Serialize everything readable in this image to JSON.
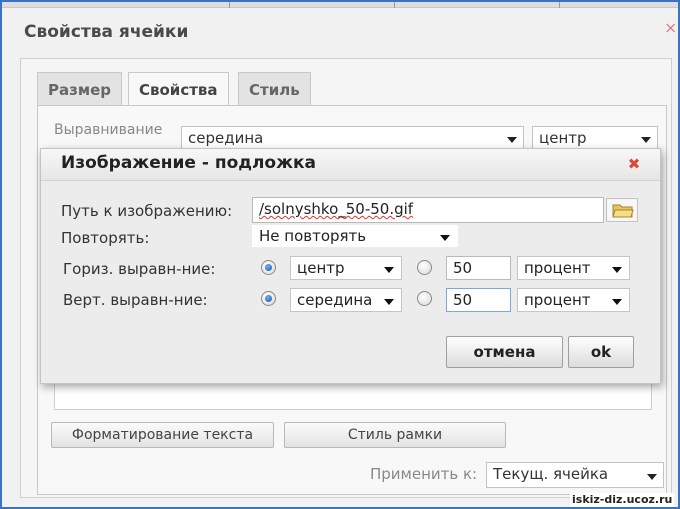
{
  "outer_dialog": {
    "title": "Свойства ячейки",
    "close_glyph": "⨯",
    "tabs": [
      {
        "label": "Размер",
        "active": false
      },
      {
        "label": "Свойства",
        "active": true
      },
      {
        "label": "Стиль",
        "active": false
      }
    ],
    "text_align_label": "Выравнивание текста:",
    "text_align_vertical": "середина",
    "text_align_horizontal": "центр",
    "format_text_button": "Форматирование текста",
    "border_style_button": "Стиль рамки",
    "apply_to_label": "Применить к:",
    "apply_to_value": "Текущ. ячейка"
  },
  "image_dialog": {
    "title": "Изображение - подложка",
    "path_label": "Путь к изображению:",
    "path_value": "/solnyshko_50-50.gif",
    "repeat_label": "Повторять:",
    "repeat_value": "Не повторять",
    "horizontal": {
      "label": "Гориз. выравн-ние:",
      "preset": "центр",
      "amount": "50",
      "unit": "процент",
      "preset_selected": true
    },
    "vertical": {
      "label": "Верт. выравн-ние:",
      "preset": "середина",
      "amount": "50",
      "unit": "процент",
      "preset_selected": true
    },
    "cancel_button": "отмена",
    "ok_button": "ok"
  },
  "watermark": "iskiz-diz.ucoz.ru",
  "colors": {
    "frame_border": "#3a73c4",
    "close_red": "#d8493c",
    "radio_blue": "#1a4f9a"
  }
}
